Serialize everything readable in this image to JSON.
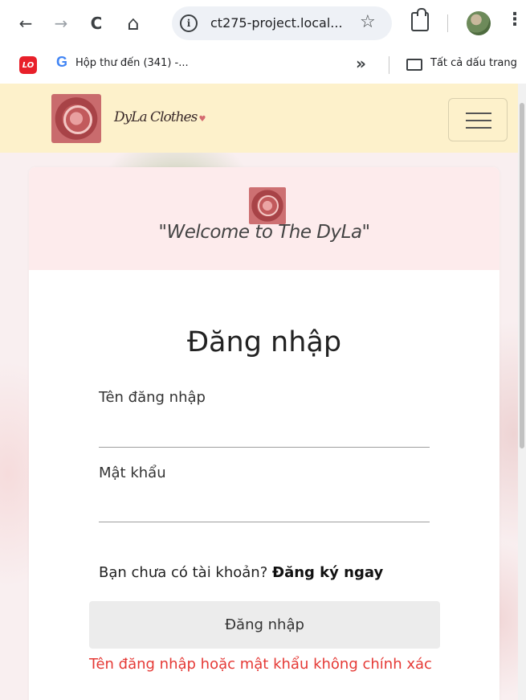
{
  "browser": {
    "url": "ct275-project.local...",
    "bookmarks": {
      "lo_label": "LO",
      "gmail_label": "Hộp thư đến (341) -...",
      "more": "»",
      "all_bookmarks": "Tất cả dấu trang"
    },
    "icons": {
      "back": "←",
      "forward": "→",
      "reload": "C",
      "home": "⌂",
      "info": "i",
      "star": "☆",
      "menu": "⋮"
    }
  },
  "navbar": {
    "brand": "DyLa Clothes"
  },
  "card": {
    "welcome": "\"Welcome to The DyLa\"",
    "title": "Đăng nhập",
    "username_label": "Tên đăng nhập",
    "username_value": "",
    "password_label": "Mật khẩu",
    "password_value": "",
    "signup_prompt": "Bạn chưa có tài khoản? ",
    "signup_link": "Đăng ký ngay",
    "login_button": "Đăng nhập",
    "error": "Tên đăng nhập hoặc mật khẩu không chính xác"
  },
  "colors": {
    "navbar_bg": "#fdf1cb",
    "card_header_bg": "#fdebec",
    "error": "#e53935",
    "button_bg": "#ececec"
  }
}
